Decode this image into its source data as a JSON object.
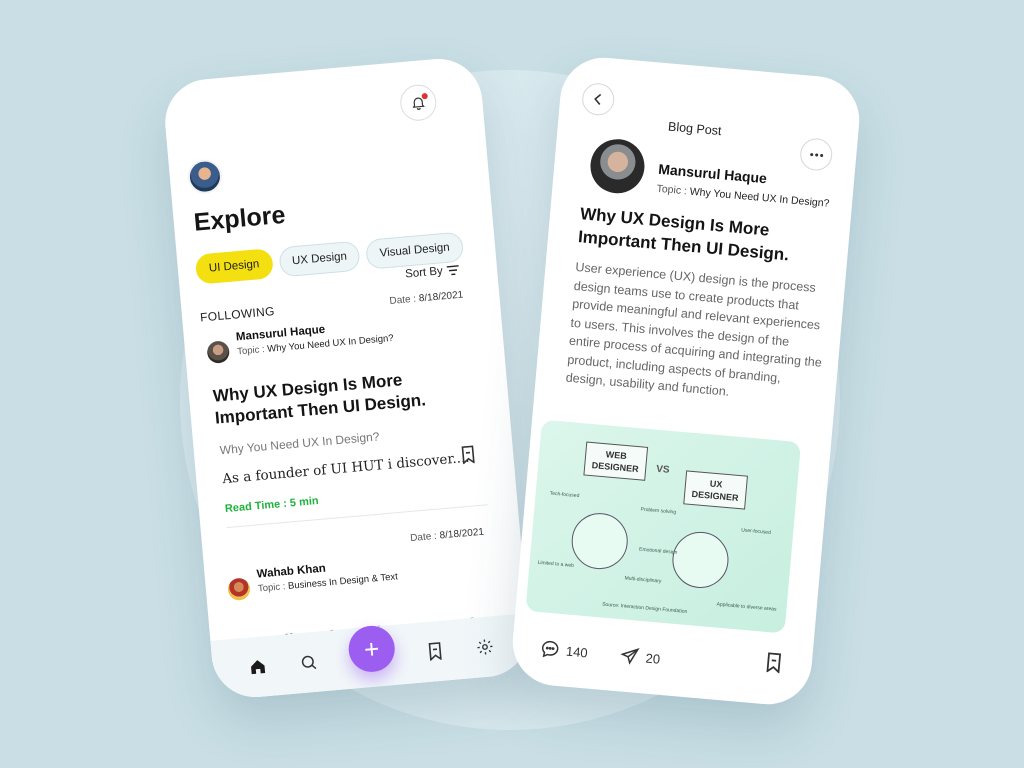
{
  "explore_screen": {
    "title": "Explore",
    "chips": [
      "UI Design",
      "UX Design",
      "Visual Design"
    ],
    "active_chip": "UI Design",
    "sort_label": "Sort By",
    "section_label": "FOLLOWING",
    "posts": [
      {
        "date_label": "Date :",
        "date": "8/18/2021",
        "author": "Mansurul Haque",
        "topic_label": "Topic :",
        "topic": "Why You Need UX In Design?",
        "title": "Why UX Design Is More Important Then UI Design.",
        "subtitle": "Why You Need UX In Design?",
        "excerpt": "As a founder of UI HUT i discover....",
        "read_time": "Read Time : 5 min"
      },
      {
        "date_label": "Date :",
        "date": "8/18/2021",
        "author": "Wahab Khan",
        "topic_label": "Topic :",
        "topic": "Business In Design & Text",
        "title": "Revealing The Uniqueness Of Your Business In Design & Text"
      }
    ],
    "nav_fab": "+"
  },
  "post_screen": {
    "page_title": "Blog Post",
    "author": "Mansurul Haque",
    "topic_label": "Topic :",
    "topic": "Why You Need UX In Design?",
    "title": "Why UX Design Is More Important Then UI Design.",
    "body": "User experience (UX) design is the process design teams use to create products that provide meaningful and relevant experiences to users. This involves the design of the entire process of acquiring and integrating the product, including aspects of branding, design, usability and function.",
    "infographic": {
      "left_box": "WEB DESIGNER",
      "vs": "VS",
      "right_box": "UX DESIGNER",
      "labels": [
        "Tech-focused",
        "Problem solving",
        "User-focused",
        "Emotional design",
        "Multi-disciplinary",
        "Limited to a web",
        "Applicable to diverse areas",
        "Source: Interaction Design Foundation"
      ]
    },
    "comments_count": "140",
    "shares_count": "20"
  },
  "colors": {
    "background": "#c9dfe5",
    "accent_yellow": "#f4df10",
    "accent_purple": "#9b5ef0",
    "read_time_green": "#1fb33d",
    "notification_red": "#e0332f"
  }
}
